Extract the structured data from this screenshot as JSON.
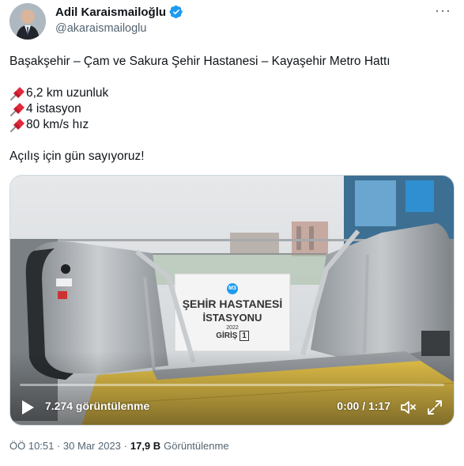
{
  "author": {
    "name": "Adil Karaismailoğlu",
    "handle": "@akaraismailoglu"
  },
  "tweet": {
    "line1": "Başakşehir – Çam ve Sakura Şehir Hastanesi – Kayaşehir Metro Hattı",
    "bullets": [
      "6,2 km uzunluk",
      "4 istasyon",
      "80 km/s hız"
    ],
    "closing": "Açılış için gün sayıyoruz!"
  },
  "video": {
    "sign_badge": "M3",
    "sign_line1": "ŞEHİR HASTANESİ",
    "sign_line2": "İSTASYONU",
    "sign_year": "2022",
    "sign_entry": "GİRİŞ",
    "sign_entry_num": "1",
    "views_label": "7.274 görüntülenme",
    "time_label": "0:00 / 1:17",
    "progress": 0
  },
  "meta": {
    "timestamp": "ÖÖ 10:51 · 30 Mar 2023 ·",
    "views_count": "17,9 B",
    "views_word": "Görüntülenme"
  },
  "icons": [
    "verified-badge-icon",
    "more-icon",
    "pin-icon",
    "play-icon",
    "volume-icon",
    "fullscreen-icon"
  ],
  "colors": {
    "verified": "#1d9bf0",
    "secondary_text": "#536471",
    "floor_yellow": "#e6c34a"
  }
}
